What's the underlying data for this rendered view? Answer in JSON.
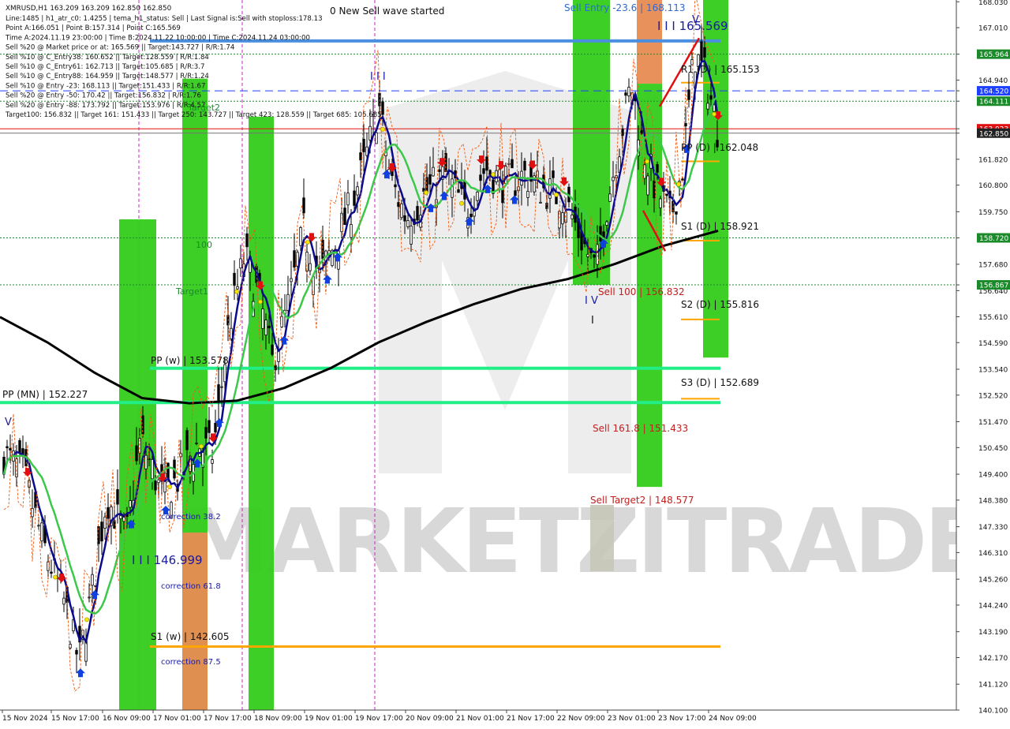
{
  "chart_data": {
    "type": "candlestick",
    "symbol": "XMRUSD,H1",
    "ohlc_header": "163.209 163.209 162.850 162.850",
    "ylim": [
      140.1,
      168.1
    ],
    "x_ticks": [
      "15 Nov 2024",
      "15 Nov 17:00",
      "16 Nov 09:00",
      "17 Nov 01:00",
      "17 Nov 17:00",
      "18 Nov 09:00",
      "19 Nov 01:00",
      "19 Nov 17:00",
      "20 Nov 09:00",
      "21 Nov 01:00",
      "21 Nov 17:00",
      "22 Nov 09:00",
      "23 Nov 01:00",
      "23 Nov 17:00",
      "24 Nov 09:00"
    ],
    "y_ticks": [
      "168.030",
      "167.010",
      "165.964",
      "164.940",
      "164.520",
      "164.111",
      "163.023",
      "162.850",
      "161.820",
      "160.800",
      "159.750",
      "158.720",
      "157.680",
      "156.867",
      "156.640",
      "155.610",
      "154.590",
      "153.540",
      "152.520",
      "151.470",
      "150.450",
      "149.400",
      "148.380",
      "147.330",
      "146.310",
      "145.260",
      "144.240",
      "143.190",
      "142.170",
      "141.120",
      "140.100"
    ],
    "y_price_badges": [
      {
        "label": "165.964",
        "value": 165.964,
        "color": "#1a8a2a"
      },
      {
        "label": "164.520",
        "value": 164.52,
        "color": "#1e40ff"
      },
      {
        "label": "164.111",
        "value": 164.111,
        "color": "#1a8a2a"
      },
      {
        "label": "163.023",
        "value": 163.023,
        "color": "#e01010"
      },
      {
        "label": "162.850",
        "value": 162.85,
        "color": "#222222"
      },
      {
        "label": "158.720",
        "value": 158.72,
        "color": "#1a8a2a"
      },
      {
        "label": "156.867",
        "value": 156.867,
        "color": "#1a8a2a"
      }
    ],
    "info_lines": [
      "Line:1485  |  h1_atr_c0: 1.4255  |  tema_h1_status: Sell  |  Last Signal is:Sell with stoploss:178.13",
      "Point A:166.051  |  Point B:157.314  |  Point C:165.569",
      "Time A:2024.11.19 23:00:00  |  Time B:2024.11.22 10:00:00  |  Time C:2024.11.24 03:00:00",
      "Sell %20 @ Market price or at: 165.569  ||  Target:143.727  |  R/R:1.74",
      "Sell %10 @ C_Entry38: 160.652  ||  Target:128.559  |  R/R:1.84",
      "Sell %10 @ C_Entry61: 162.713  ||  Target:105.685  |  R/R:3.7",
      "Sell %10 @ C_Entry88: 164.959  ||  Target:148.577  |  R/R:1.24",
      "Sell %10 @ Entry -23: 168.113  ||  Target:151.433  |  R/R:1.67",
      "Sell %20 @ Entry -50: 170.42  ||  Target:156.832  |  R/R:1.76",
      "Sell %20 @ Entry -88: 173.792  ||  Target:153.976  |  R/R:4.57",
      "Target100: 156.832  ||  Target 161: 151.433  ||  Target 250: 143.727  ||  Target 423: 128.559  ||  Target 685: 105.685"
    ],
    "annotations": [
      {
        "text": "0 New Sell wave started",
        "color": "#111111"
      },
      {
        "text": "Sell Entry -23.6 | 168.113",
        "color": "#2b6ad6"
      },
      {
        "text": "I I I 165.569",
        "color": "#1a1aa0"
      },
      {
        "text": "R1 (D) | 165.153",
        "color": "#111111"
      },
      {
        "text": "PP (D) | 162.048",
        "color": "#111111"
      },
      {
        "text": "S1 (D) | 158.921",
        "color": "#111111"
      },
      {
        "text": "S2 (D) | 155.816",
        "color": "#111111"
      },
      {
        "text": "S3 (D) | 152.689",
        "color": "#111111"
      },
      {
        "text": "Sell 100 | 156.832",
        "color": "#c02020"
      },
      {
        "text": "Sell 161.8 | 151.433",
        "color": "#c02020"
      },
      {
        "text": "Sell Target2 | 148.577",
        "color": "#c02020"
      },
      {
        "text": "PP (w) | 153.578",
        "color": "#111111"
      },
      {
        "text": "PP (MN) | 152.227",
        "color": "#111111"
      },
      {
        "text": "S1 (w) | 142.605",
        "color": "#111111"
      },
      {
        "text": "I I I 146.999",
        "color": "#1a1aa0"
      },
      {
        "text": "correction 38.2",
        "color": "#1a1aa0"
      },
      {
        "text": "correction 61.8",
        "color": "#1a1aa0"
      },
      {
        "text": "correction 87.5",
        "color": "#1a1aa0"
      },
      {
        "text": "100",
        "color": "#1a8a2a"
      },
      {
        "text": "Target1",
        "color": "#1a8a2a"
      },
      {
        "text": "Target2",
        "color": "#1a8a2a"
      },
      {
        "text": "I I I",
        "color": "#1a1aa0"
      },
      {
        "text": "I V",
        "color": "#1a1aa0"
      },
      {
        "text": "V",
        "color": "#1a1aa0"
      },
      {
        "text": "I",
        "color": "#111111"
      }
    ],
    "levels": {
      "r1_w": 166.487,
      "sell_entry": 168.113,
      "wave_c": 165.569,
      "r1_d": 165.153,
      "pp_d": 162.048,
      "s1_d": 158.921,
      "s2_d": 155.816,
      "s3_d": 152.689,
      "pp_w": 153.578,
      "pp_mn": 152.227,
      "s1_w": 142.605,
      "sell_100": 156.832,
      "sell_161": 151.433,
      "sell_target2": 148.577,
      "wave_iii_low": 146.999
    },
    "watermark": "MARKETZITRADE",
    "colors": {
      "green_band": "#33cc1a",
      "orange_band": "#e88b52",
      "tema_fast": "#0a0a8a",
      "ma_green": "#3cc84a",
      "ma_black": "#000000",
      "pivot_line": "#22ee88",
      "s1w_line": "#ffa500",
      "sell_arrow": "#e01010",
      "buy_arrow": "#1040e0",
      "trail": "#f05a10",
      "r1w_line": "#4a8fe0"
    }
  }
}
